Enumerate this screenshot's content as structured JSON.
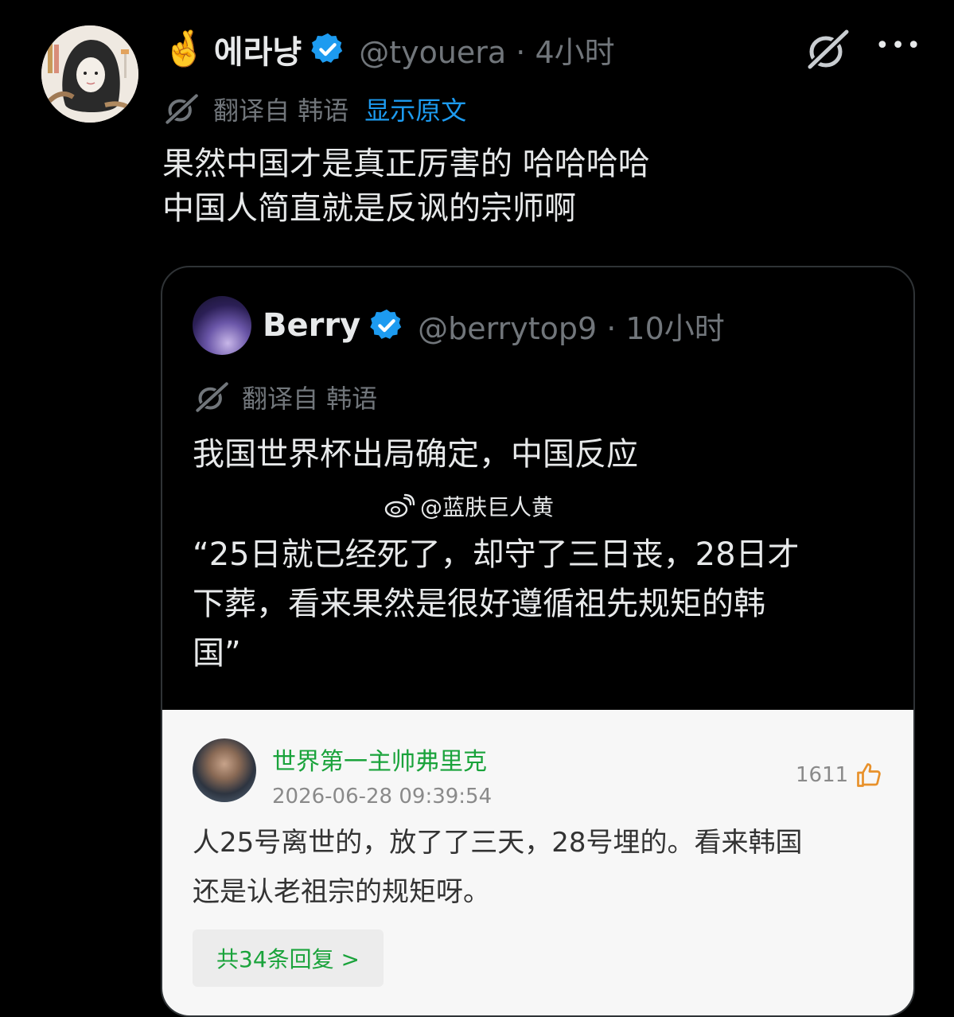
{
  "post": {
    "emoji": "🤞",
    "name": "에라냥",
    "handle_time": "@tyouera · 4小时",
    "translate_label": "翻译自 韩语",
    "show_original": "显示原文",
    "text": "果然中国才是真正厉害的 哈哈哈哈\n中国人简直就是反讽的宗师啊"
  },
  "quote": {
    "name": "Berry",
    "handle_time": "@berrytop9 · 10小时",
    "translate_label": "翻译自 韩语",
    "title": "我国世界杯出局确定，中国反应",
    "weibo_watermark": "@蓝肤巨人黄",
    "quote_text": "“25日就已经死了，却守了三日丧，28日才\n下葬，看来果然是很好遵循祖先规矩的韩\n国”"
  },
  "comment": {
    "username": "世界第一主帅弗里克",
    "timestamp": "2026-06-28 09:39:54",
    "likes": "1611",
    "text": "人25号离世的，放了了三天，28号埋的。看来韩国\n还是认老祖宗的规矩呀。",
    "replies_button": "共34条回复 >"
  },
  "icons": {
    "verified": "verified-badge-icon",
    "grok": "grok-icon",
    "more": "more-icon",
    "translate": "translate-icon",
    "weibo": "weibo-icon",
    "like": "thumbs-up-icon"
  },
  "colors": {
    "background": "#000000",
    "verified_blue": "#1d9bf0",
    "muted_text": "#71767b",
    "link_blue": "#1d9bf0",
    "weibo_green": "#1aa33b"
  }
}
